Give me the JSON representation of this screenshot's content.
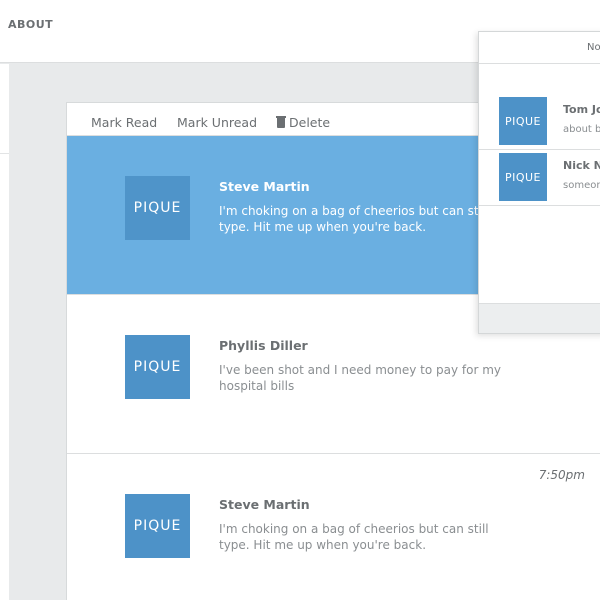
{
  "nav": {
    "about": "ABOUT"
  },
  "toolbar": {
    "mark_read": "Mark Read",
    "mark_unread": "Mark Unread",
    "delete": "Delete"
  },
  "messages": [
    {
      "logo": "PIQUE",
      "sender": "Steve Martin",
      "body": "I'm choking on a bag of cheerios but can still type. Hit me up when you're back.",
      "time": "",
      "selected": true
    },
    {
      "logo": "PIQUE",
      "sender": "Phyllis Diller",
      "body": "I've been shot and I need money to pay for my hospital bills",
      "time": ""
    },
    {
      "logo": "PIQUE",
      "sender": "Steve Martin",
      "body": "I'm choking on a bag of cheerios but can still type. Hit me up when you're back.",
      "time": "7:50pm"
    }
  ],
  "notifications": {
    "header": "No",
    "items": [
      {
        "logo": "PIQUE",
        "name": "Tom Jo",
        "snippet": "about ba"
      },
      {
        "logo": "PIQUE",
        "name": "Nick No",
        "snippet": "someon"
      }
    ]
  },
  "colors": {
    "selected_row": "#6aafe1",
    "logo_bg": "#4d92c8",
    "page_bg": "#e8eaeb"
  }
}
